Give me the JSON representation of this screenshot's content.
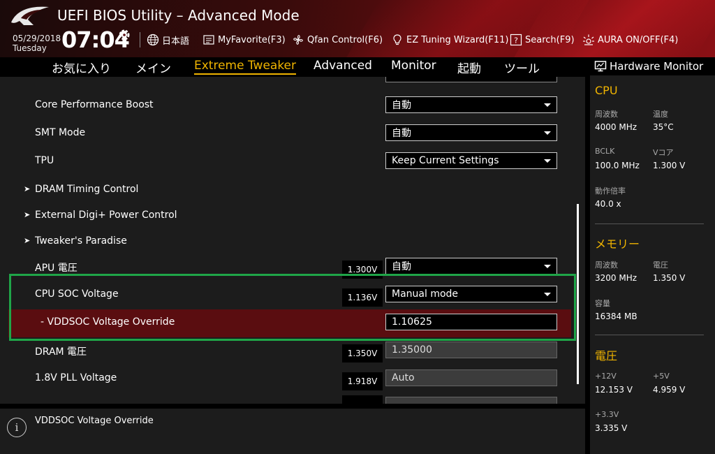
{
  "header": {
    "title": "UEFI BIOS Utility – Advanced Mode",
    "date": "05/29/2018",
    "day": "Tuesday",
    "time": "07:04",
    "items": [
      {
        "label": "日本語",
        "icon": "globe-icon"
      },
      {
        "label": "MyFavorite(F3)",
        "icon": "favorite-icon"
      },
      {
        "label": "Qfan Control(F6)",
        "icon": "fan-icon"
      },
      {
        "label": "EZ Tuning Wizard(F11)",
        "icon": "lightbulb-icon"
      },
      {
        "label": "Search(F9)",
        "icon": "question-icon"
      },
      {
        "label": "AURA ON/OFF(F4)",
        "icon": "aura-icon"
      }
    ]
  },
  "tabs": [
    {
      "label": "お気に入り",
      "active": false
    },
    {
      "label": "メイン",
      "active": false
    },
    {
      "label": "Extreme Tweaker",
      "active": true
    },
    {
      "label": "Advanced",
      "active": false
    },
    {
      "label": "Monitor",
      "active": false
    },
    {
      "label": "起動",
      "active": false
    },
    {
      "label": "ツール",
      "active": false
    }
  ],
  "settings": [
    {
      "label": "Core Performance Boost",
      "control": "dropdown",
      "value": "自動"
    },
    {
      "label": "SMT Mode",
      "control": "dropdown",
      "value": "自動"
    },
    {
      "label": "TPU",
      "control": "dropdown",
      "value": "Keep Current Settings"
    },
    {
      "label": "DRAM Timing Control",
      "control": "submenu"
    },
    {
      "label": "External Digi+ Power Control",
      "control": "submenu"
    },
    {
      "label": "Tweaker's Paradise",
      "control": "submenu"
    },
    {
      "label": "APU 電圧",
      "voltage": "1.300V",
      "control": "dropdown",
      "value": "自動"
    },
    {
      "label": "CPU SOC Voltage",
      "voltage": "1.136V",
      "control": "dropdown",
      "value": "Manual mode"
    },
    {
      "label": "- VDDSOC Voltage Override",
      "control": "text",
      "value": "1.10625"
    },
    {
      "label": "DRAM 電圧",
      "voltage": "1.350V",
      "control": "text-disabled",
      "value": "1.35000"
    },
    {
      "label": "1.8V PLL Voltage",
      "voltage": "1.918V",
      "control": "text-disabled",
      "value": "Auto"
    }
  ],
  "help": {
    "text": "VDDSOC Voltage Override"
  },
  "hwmon": {
    "title": "Hardware Monitor",
    "cpu": {
      "heading": "CPU",
      "freq_label": "周波数",
      "freq_value": "4000 MHz",
      "temp_label": "温度",
      "temp_value": "35°C",
      "bclk_label": "BCLK",
      "bclk_value": "100.0 MHz",
      "vcore_label": "Vコア",
      "vcore_value": "1.300 V",
      "ratio_label": "動作倍率",
      "ratio_value": "40.0 x"
    },
    "memory": {
      "heading": "メモリー",
      "freq_label": "周波数",
      "freq_value": "3200 MHz",
      "volt_label": "電圧",
      "volt_value": "1.350 V",
      "cap_label": "容量",
      "cap_value": "16384 MB"
    },
    "voltage": {
      "heading": "電圧",
      "v12_label": "+12V",
      "v12_value": "12.153 V",
      "v5_label": "+5V",
      "v5_value": "4.959 V",
      "v33_label": "+3.3V",
      "v33_value": "3.335 V"
    }
  }
}
